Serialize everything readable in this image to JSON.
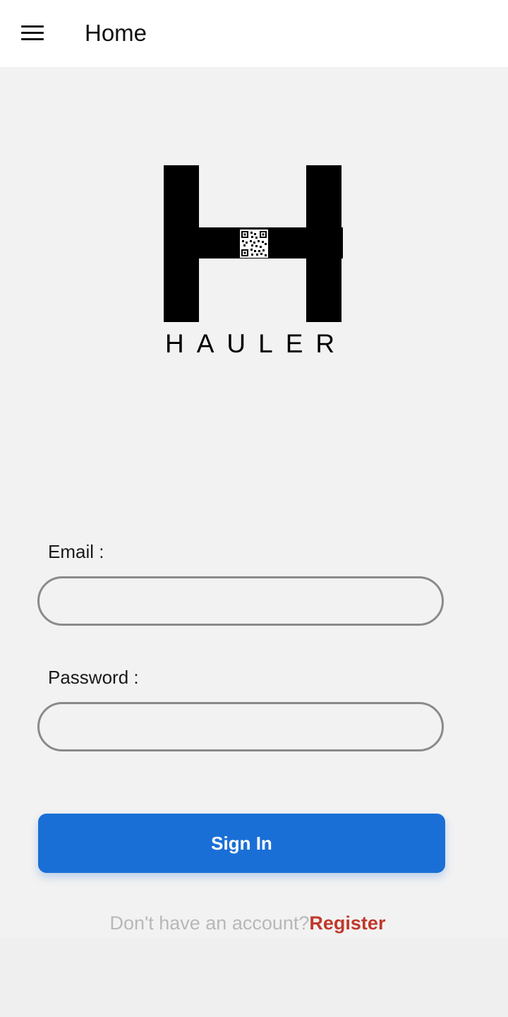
{
  "app_bar": {
    "title": "Home",
    "menu_icon": "hamburger-menu-icon"
  },
  "logo": {
    "brand_text": "HAULER",
    "icon": "qr-code-icon"
  },
  "form": {
    "email_label": "Email :",
    "email_value": "",
    "password_label": "Password :",
    "password_value": "",
    "sign_in_label": "Sign In"
  },
  "footer": {
    "no_account_text": "Don't have an account?",
    "register_label": "Register"
  },
  "colors": {
    "primary": "#1a6fd6",
    "register": "#c0392b",
    "background": "#f2f2f2"
  }
}
